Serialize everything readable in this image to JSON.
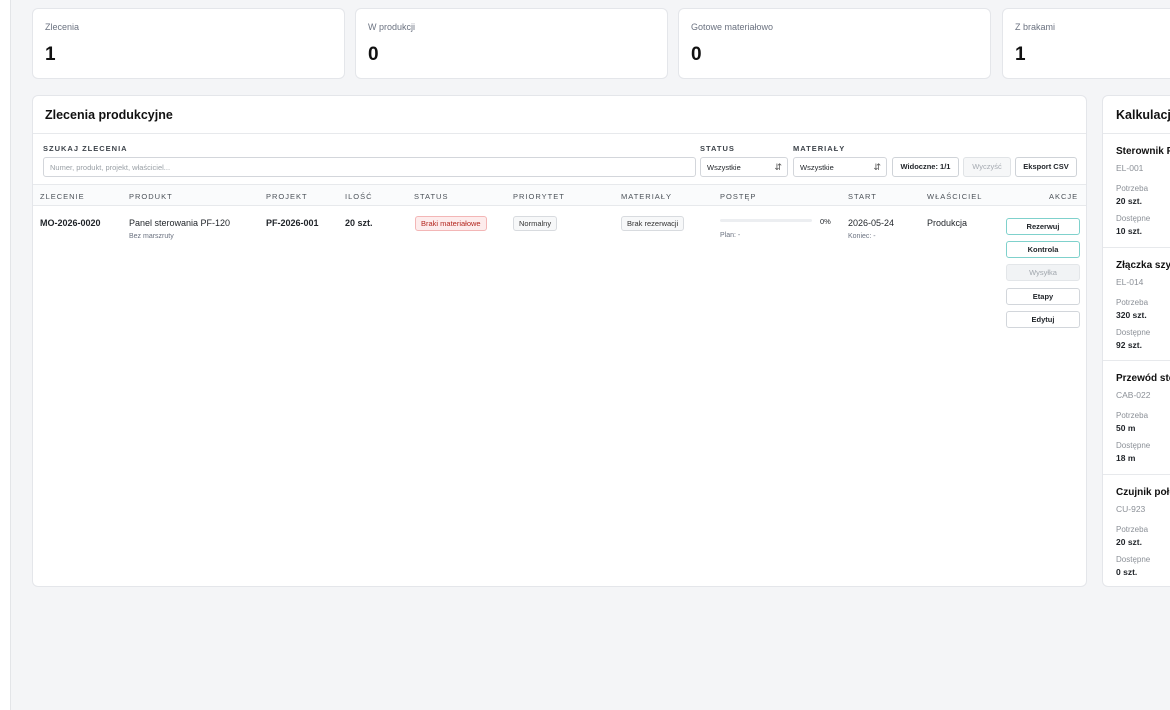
{
  "stats": [
    {
      "label": "Zlecenia",
      "value": "1"
    },
    {
      "label": "W produkcji",
      "value": "0"
    },
    {
      "label": "Gotowe materiałowo",
      "value": "0"
    },
    {
      "label": "Z brakami",
      "value": "1"
    }
  ],
  "orders": {
    "title": "Zlecenia produkcyjne",
    "filters": {
      "search_label": "SZUKAJ ZLECENIA",
      "search_placeholder": "Numer, produkt, projekt, właściciel...",
      "search_value": "",
      "status_label": "STATUS",
      "status_value": "Wszystkie",
      "materials_label": "MATERIAŁY",
      "materials_value": "Wszystkie",
      "visible_label": "Widoczne: 1/1",
      "clear_label": "Wyczyść",
      "export_label": "Eksport CSV"
    },
    "columns": [
      "ZLECENIE",
      "PRODUKT",
      "PROJEKT",
      "ILOŚĆ",
      "STATUS",
      "PRIORYTET",
      "MATERIAŁY",
      "POSTĘP",
      "START",
      "WŁAŚCICIEL",
      "AKCJE"
    ],
    "rows": [
      {
        "order": "MO-2026-0020",
        "product": "Panel sterowania PF-120",
        "route": "Bez marszruty",
        "project": "PF-2026-001",
        "qty": "20 szt.",
        "status": "Braki materiałowe",
        "priority": "Normalny",
        "materials": "Brak rezerwacji",
        "progress_pct": 0,
        "progress_label": "0%",
        "plan": "Plan: -",
        "start": "2026-05-24",
        "end": "Koniec: -",
        "owner": "Produkcja",
        "actions": [
          "Rezerwuj",
          "Kontrola",
          "Wysyłka",
          "Etapy",
          "Edytuj"
        ]
      }
    ]
  },
  "calculation": {
    "title": "Kalkulacja",
    "need_label": "Potrzeba",
    "available_label": "Dostępne",
    "items": [
      {
        "name": "Sterownik PLC",
        "code": "EL-001",
        "need": "20 szt.",
        "available": "10 szt."
      },
      {
        "name": "Złączka szynowa",
        "code": "EL-014",
        "need": "320 szt.",
        "available": "92 szt."
      },
      {
        "name": "Przewód sterowniczy",
        "code": "CAB-022",
        "need": "50 m",
        "available": "18 m"
      },
      {
        "name": "Czujnik położenia",
        "code": "CU-923",
        "need": "20 szt.",
        "available": "0 szt."
      }
    ]
  },
  "colors": {
    "accent": "#3b82f6",
    "teal_border": "#7fd1cc",
    "danger_bg": "#fdecec",
    "danger_text": "#b3261e"
  }
}
